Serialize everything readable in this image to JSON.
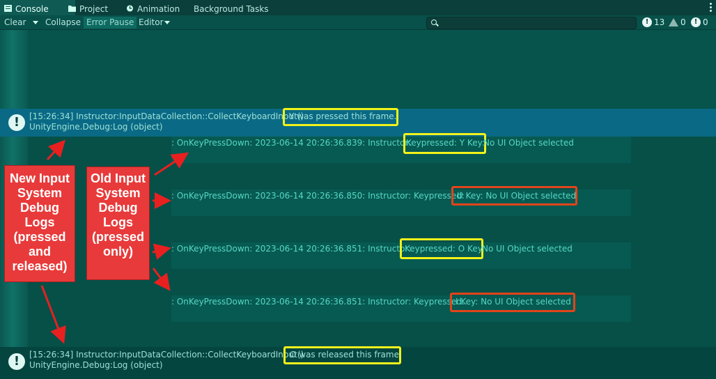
{
  "tabs": [
    {
      "label": "Console",
      "icon": "console-icon",
      "active": true
    },
    {
      "label": "Project",
      "icon": "folder-icon"
    },
    {
      "label": "Animation",
      "icon": "animation-icon"
    },
    {
      "label": "Background Tasks"
    }
  ],
  "toolbar": {
    "clear": "Clear",
    "collapse": "Collapse",
    "error_pause": "Error Pause",
    "editor": "Editor"
  },
  "counts": {
    "info": "13",
    "warnings": "0",
    "errors": "0"
  },
  "new_log_1": {
    "line1": "[15:26:34] Instructor:InputDataCollection::CollectKeyboardInput()",
    "highlight": "Y was pressed this frame.",
    "line2": "UnityEngine.Debug:Log (object)"
  },
  "old_logs": [
    {
      "prefix": ": OnKeyPressDown: 2023-06-14 20:26:36.839: Instructor: ",
      "highlight": "Keypressed: Y Key:",
      "suffix": " No UI Object selected"
    },
    {
      "prefix": ": OnKeyPressDown: 2023-06-14 20:26:36.850: Instructor:  Keypressed: ",
      "highlight": "U Key: No UI Object selected",
      "suffix": ""
    },
    {
      "prefix": ": OnKeyPressDown: 2023-06-14 20:26:36.851: Instructor: ",
      "highlight": "Keypressed: O Key:",
      "suffix": " No UI Object selected"
    },
    {
      "prefix": ": OnKeyPressDown: 2023-06-14 20:26:36.851: Instructor:  Keypressed: ",
      "highlight": "I Key: No UI Object selected",
      "suffix": ""
    }
  ],
  "new_log_2": {
    "line1": "[15:26:34] Instructor:InputDataCollection::CollectKeyboardInput()",
    "highlight": "O was released this frame.",
    "line2": "UnityEngine.Debug:Log (object)"
  },
  "annotations": {
    "new_label": "New Input System Debug Logs (pressed and released)",
    "old_label": "Old Input System Debug Logs (pressed only)"
  },
  "colors": {
    "highlight_yellow": "#f2f21a",
    "highlight_red": "#e2441a",
    "label_bg": "#e83a3a",
    "selected_row": "#0a6a85"
  }
}
